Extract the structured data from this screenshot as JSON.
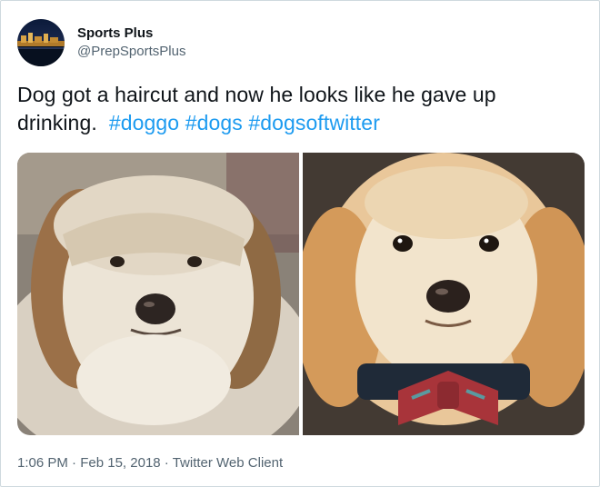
{
  "author": {
    "display_name": "Sports Plus",
    "handle": "@PrepSportsPlus"
  },
  "tweet": {
    "text": "Dog got a haircut and now he looks like he gave up drinking.",
    "hashtags": [
      "#doggo",
      "#dogs",
      "#dogsoftwitter"
    ]
  },
  "media": {
    "photos": [
      {
        "icon": "dog-before-haircut-photo"
      },
      {
        "icon": "dog-after-haircut-photo"
      }
    ]
  },
  "meta": {
    "time": "1:06 PM",
    "separator": "·",
    "date": "Feb 15, 2018",
    "client": "Twitter Web Client"
  },
  "colors": {
    "link": "#1d9bf0",
    "secondary_text": "#536471",
    "border": "#cfd9de"
  }
}
